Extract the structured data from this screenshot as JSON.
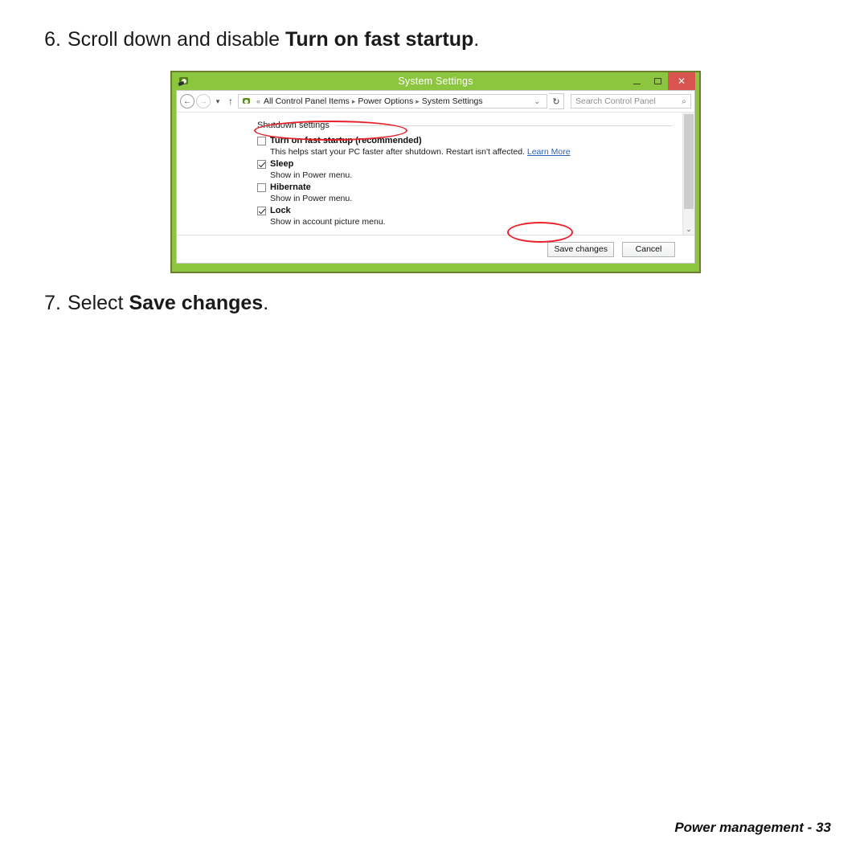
{
  "steps": [
    {
      "number": "6.",
      "text_before": "Scroll down and disable ",
      "bold": "Turn on fast startup",
      "text_after": "."
    },
    {
      "number": "7.",
      "text_before": "Select ",
      "bold": "Save changes",
      "text_after": "."
    }
  ],
  "window": {
    "title": "System Settings",
    "icon": "control-panel-power-icon",
    "controls": {
      "minimize": "–",
      "maximize": "□",
      "close": "✕"
    },
    "frame_color": "#8cc63f",
    "close_color": "#d9534f"
  },
  "navbar": {
    "back": "←",
    "forward": "→",
    "recent": "▾",
    "up": "↑",
    "path_prefix": "«",
    "breadcrumbs": [
      "All Control Panel Items",
      "Power Options",
      "System Settings"
    ],
    "separator": "▸",
    "dropdown_caret": "⌄",
    "refresh": "↻",
    "search_placeholder": "Search Control Panel",
    "search_icon": "⌕"
  },
  "content": {
    "group_title": "Shutdown settings",
    "options": [
      {
        "label": "Turn on fast startup (recommended)",
        "checked": false,
        "description": "This helps start your PC faster after shutdown. Restart isn't affected. ",
        "link": "Learn More",
        "highlighted": true
      },
      {
        "label": "Sleep",
        "checked": true,
        "description": "Show in Power menu.",
        "link": "",
        "highlighted": false
      },
      {
        "label": "Hibernate",
        "checked": false,
        "description": "Show in Power menu.",
        "link": "",
        "highlighted": false
      },
      {
        "label": "Lock",
        "checked": true,
        "description": "Show in account picture menu.",
        "link": "",
        "highlighted": false
      }
    ],
    "scrollbar_arrow": "⌄"
  },
  "footer_buttons": {
    "save": "Save changes",
    "cancel": "Cancel"
  },
  "annotation": {
    "color": "#e8222a",
    "targets": [
      "turn-on-fast-startup-option",
      "save-changes-button"
    ]
  },
  "page_footer": {
    "section": "Power management",
    "dash": "-",
    "page_number": "33"
  }
}
